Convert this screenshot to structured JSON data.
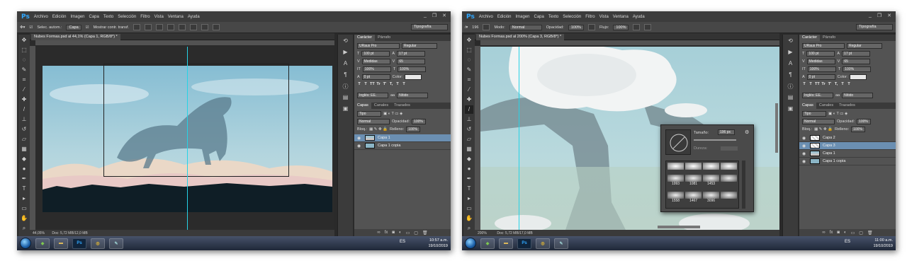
{
  "menu": [
    "Archivo",
    "Edición",
    "Imagen",
    "Capa",
    "Texto",
    "Selección",
    "Filtro",
    "Vista",
    "Ventana",
    "Ayuda"
  ],
  "app_logo": "Ps",
  "window_controls": [
    "_",
    "❐",
    "✕"
  ],
  "workspace": "Tipografía",
  "screen1": {
    "options": {
      "auto_select": "Selec. autom.:",
      "auto_select_target": "Capa",
      "transform": "Mostrar contr. transf."
    },
    "doc_tab": "Nubes Formas.psd al 44,1% (Capa 1, RGB/8*) *",
    "zoom": "44,05%",
    "doc_info": "Doc: 5,72 MB/12,0 MB",
    "layers": [
      {
        "name": "Capa 1",
        "selected": true
      },
      {
        "name": "Capa 1 copia",
        "selected": false
      }
    ],
    "fill_pct": "100%",
    "opacity_pct": "100%",
    "blend": "Normal",
    "time": "10:57 a.m.",
    "date": "19/10/2019"
  },
  "screen2": {
    "options": {
      "brush_size": "196",
      "mode_label": "Modo:",
      "mode": "Normal",
      "opacity_label": "Opacidad:",
      "opacity": "100%",
      "flow_label": "Flujo:",
      "flow": "100%"
    },
    "doc_tab": "Nubes Formas.psd al 200% (Capa 3, RGB/8*) *",
    "zoom": "200%",
    "doc_info": "Doc: 5,72 MB/17,0 MB",
    "layers": [
      {
        "name": "Capa 2",
        "selected": false
      },
      {
        "name": "Capa 3",
        "selected": true
      },
      {
        "name": "Capa 1",
        "selected": false
      },
      {
        "name": "Capa 1 copia",
        "selected": false
      }
    ],
    "fill_pct": "100%",
    "opacity_pct": "100%",
    "blend": "Normal",
    "brush_popup": {
      "size_label": "Tamaño:",
      "size_value": "196 px",
      "hardness_label": "Dureza:",
      "presets": [
        "1993",
        "1081",
        "1453",
        "1558",
        "1467",
        "3096"
      ]
    },
    "time": "11:00 a.m.",
    "date": "19/10/2019"
  },
  "character_panel": {
    "tabs": [
      "Carácter",
      "Párrafo"
    ],
    "font_family": "URaus Pro",
    "font_style": "Regular",
    "size": "100 pt",
    "leading": "17 pt",
    "kerning": "Medidas",
    "tracking": "65",
    "vert_scale": "100%",
    "horiz_scale": "100%",
    "baseline": "0 pt",
    "color_label": "Color:",
    "language": "Inglés: EE.",
    "antialias": "Nítido",
    "style_buttons": [
      "T",
      "T",
      "TT",
      "Tr",
      "T'",
      "T,",
      "T",
      "T"
    ]
  },
  "layers_panel": {
    "tabs": [
      "Capas",
      "Canales",
      "Trazados"
    ],
    "kind": "Tipo",
    "opacity_label": "Opacidad:",
    "lock_label": "Bloq.:",
    "fill_label": "Relleno:"
  },
  "taskbar": {
    "ps_label": "Ps",
    "lang": "ES"
  }
}
